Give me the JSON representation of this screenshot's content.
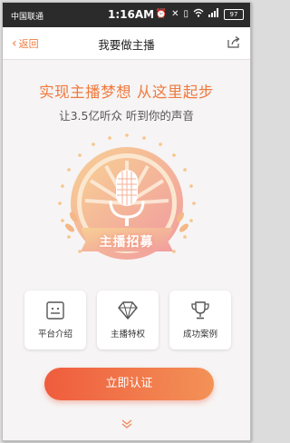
{
  "status_bar": {
    "carrier": "中国联通",
    "time": "1:16AM",
    "battery": "97"
  },
  "nav": {
    "back_label": "返回",
    "title": "我要做主播"
  },
  "hero": {
    "headline": "实现主播梦想 从这里起步",
    "subline": "让3.5亿听众 听到你的声音",
    "badge_text": "主播招募"
  },
  "features": [
    {
      "label": "平台介绍",
      "icon": "platform-intro-icon"
    },
    {
      "label": "主播特权",
      "icon": "diamond-icon"
    },
    {
      "label": "成功案例",
      "icon": "trophy-icon"
    }
  ],
  "cta": {
    "label": "立即认证"
  },
  "colors": {
    "accent": "#ef7a3f",
    "cta_start": "#ef5c3d",
    "cta_end": "#f39257",
    "badge_gold": "#f6c58a",
    "badge_pink": "#f3a39a"
  }
}
